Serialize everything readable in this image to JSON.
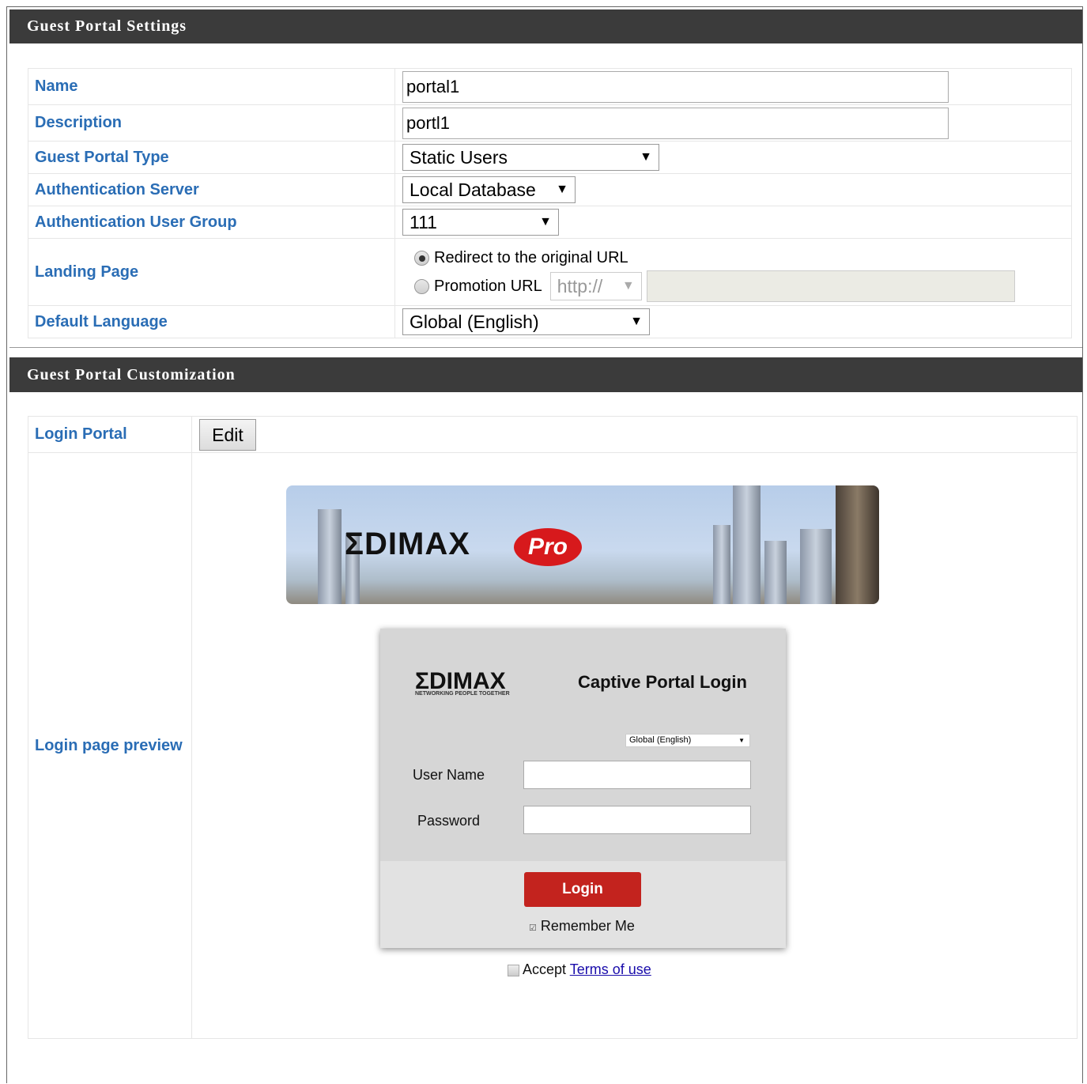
{
  "settings": {
    "header": "Guest Portal Settings",
    "name_label": "Name",
    "name_value": "portal1",
    "description_label": "Description",
    "description_value": "portl1",
    "portal_type_label": "Guest Portal Type",
    "portal_type_value": "Static Users",
    "auth_server_label": "Authentication Server",
    "auth_server_value": "Local Database",
    "auth_group_label": "Authentication User Group",
    "auth_group_value": "111",
    "landing_label": "Landing Page",
    "landing_option1": "Redirect to the original URL",
    "landing_option2": "Promotion URL",
    "promotion_protocol": "http://",
    "promotion_url_value": "",
    "language_label": "Default Language",
    "language_value": "Global (English)"
  },
  "customization": {
    "header": "Guest Portal Customization",
    "login_portal_label": "Login Portal",
    "edit_button": "Edit",
    "preview_label": "Login page preview"
  },
  "preview": {
    "banner_brand": "ΣDIMAX",
    "banner_badge": "Pro",
    "card_brand": "ΣDIMAX",
    "card_tagline": "NETWORKING PEOPLE TOGETHER",
    "card_title": "Captive Portal Login",
    "language_select": "Global (English)",
    "username_label": "User Name",
    "password_label": "Password",
    "login_button": "Login",
    "remember_me": "Remember Me",
    "accept_text": "Accept",
    "terms_link": "Terms of use"
  },
  "colors": {
    "header_bg": "#3b3b3b",
    "label_blue": "#2a6db5",
    "login_red": "#c3231e",
    "link_blue": "#1a0dab"
  }
}
